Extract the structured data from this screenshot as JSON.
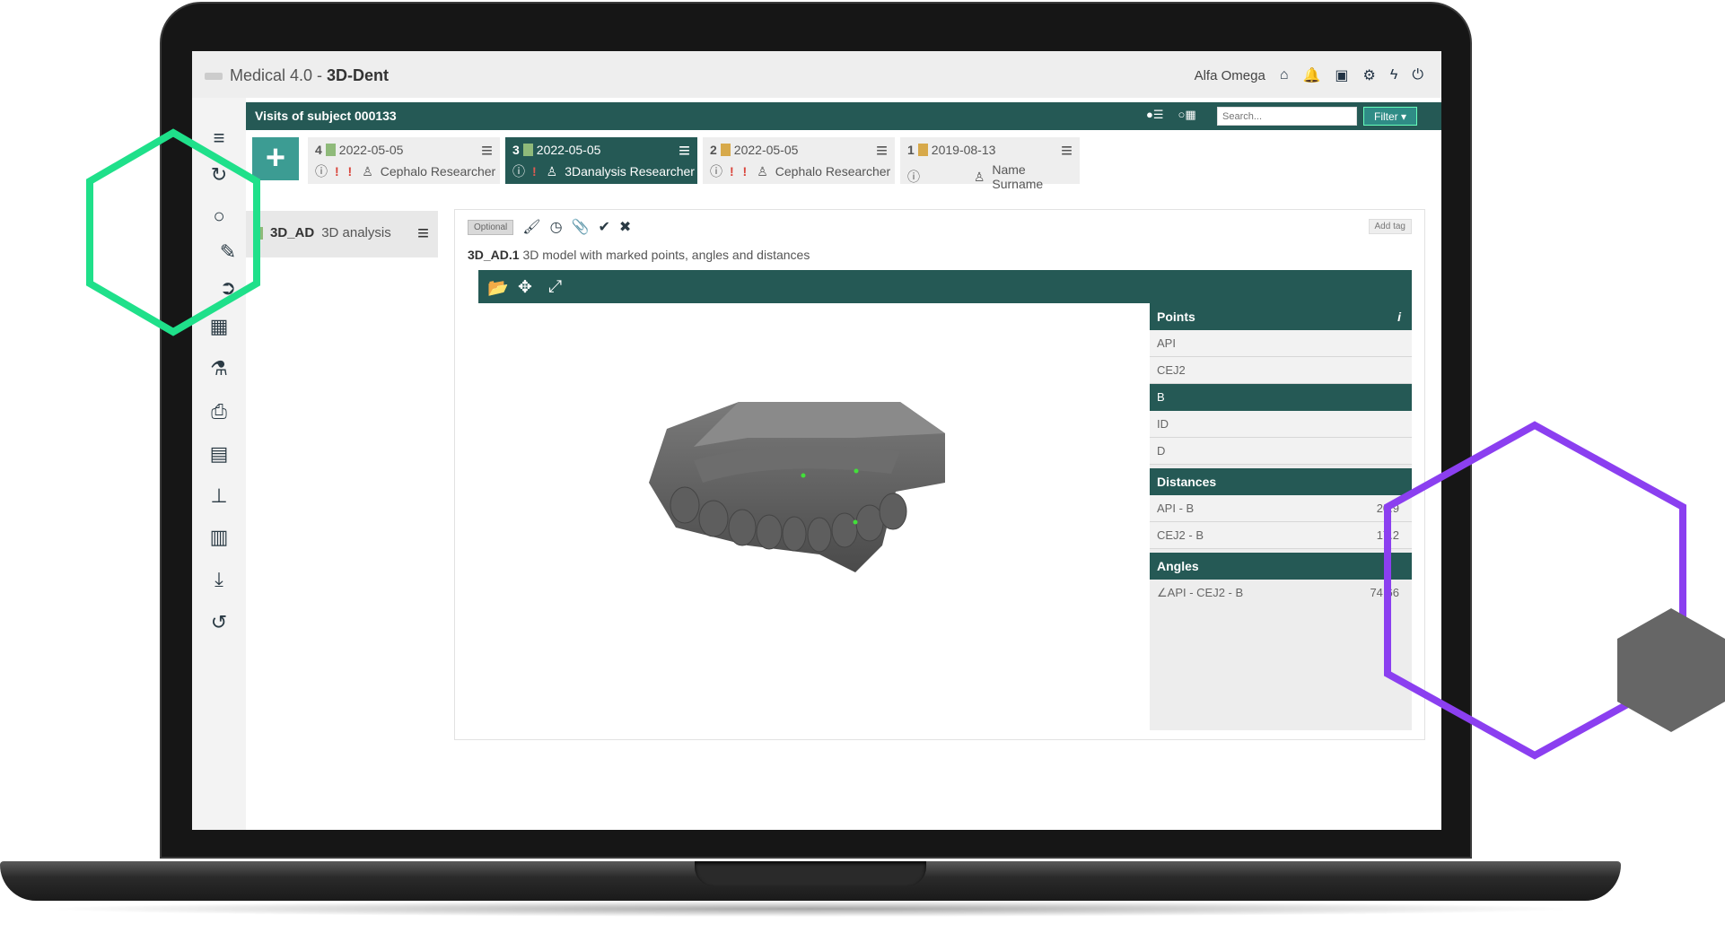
{
  "app": {
    "title_prefix": "Medical 4.0 - ",
    "title_bold": "3D-Dent",
    "user_name": "Alfa Omega"
  },
  "visits": {
    "header": "Visits of subject 000133",
    "search_placeholder": "Search...",
    "filter_label": "Filter ▾",
    "add_label": "+",
    "cards": [
      {
        "num": "4",
        "date": "2022-05-05",
        "warn": "! !",
        "researcher": "Cephalo Researcher",
        "color": "#8fba7a",
        "active": false
      },
      {
        "num": "3",
        "date": "2022-05-05",
        "warn": "!",
        "researcher": "3Danalysis Researcher",
        "color": "#8fba7a",
        "active": true
      },
      {
        "num": "2",
        "date": "2022-05-05",
        "warn": "! !",
        "researcher": "Cephalo Researcher",
        "color": "#d7a94a",
        "active": false
      },
      {
        "num": "1",
        "date": "2019-08-13",
        "warn": "",
        "researcher": "Name Surname",
        "color": "#d7a94a",
        "active": false
      }
    ]
  },
  "module": {
    "code": "3D_AD",
    "name": "3D analysis",
    "color": "#8fba7a"
  },
  "panel": {
    "optional_label": "Optional",
    "add_tag_label": "Add tag",
    "section_code": "3D_AD.1",
    "section_title": "3D model with marked points, angles and distances"
  },
  "side": {
    "points_title": "Points",
    "info_icon": "i",
    "points": [
      "API",
      "CEJ2",
      "B",
      "ID",
      "D"
    ],
    "selected_point": "B",
    "distances_title": "Distances",
    "distances": [
      {
        "label": "API - B",
        "value": "20.9"
      },
      {
        "label": "CEJ2 - B",
        "value": "17.2"
      }
    ],
    "angles_title": "Angles",
    "angles": [
      {
        "label": "∠API - CEJ2 - B",
        "value": "74.66"
      }
    ]
  },
  "icons": {
    "menu": "hamburger-icon",
    "home": "home-icon",
    "bell": "bell-icon",
    "card": "id-card-icon",
    "gear": "gear-icon",
    "bolt": "bolt-icon",
    "power": "power-icon"
  },
  "colors": {
    "primary": "#255955",
    "accent": "#3c9c93",
    "warning": "#d9443b",
    "hex_green": "#1fe08a",
    "hex_purple": "#8b3ff0",
    "hex_gray": "#666666"
  }
}
